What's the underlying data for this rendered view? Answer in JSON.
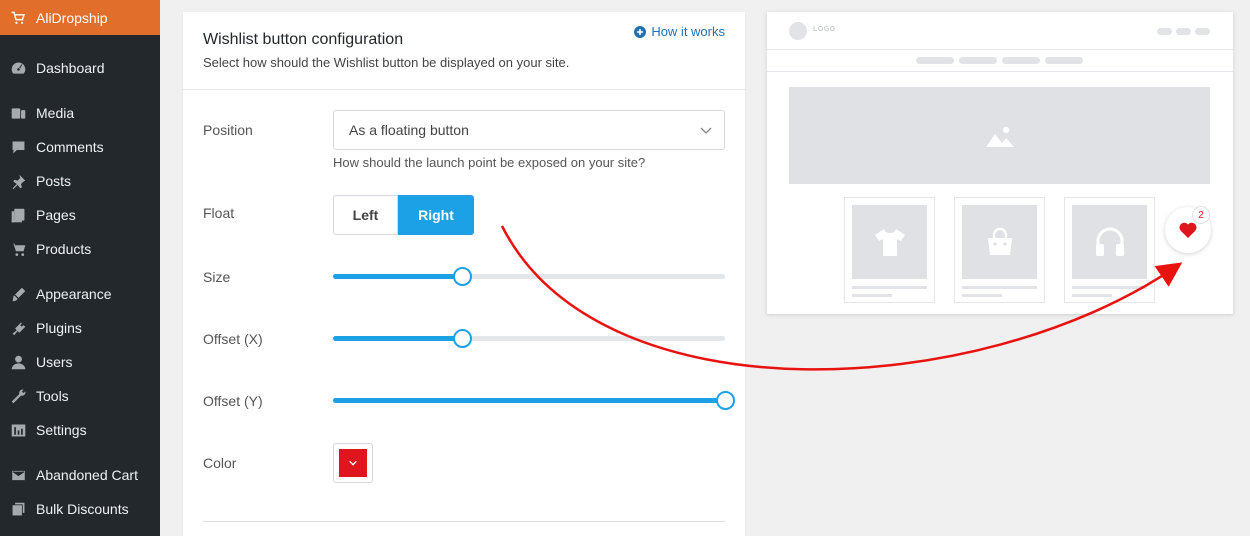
{
  "sidebar": {
    "brand": "AliDropship",
    "items": [
      {
        "label": "Dashboard",
        "icon": "dashboard-icon"
      },
      {
        "label": "Media",
        "icon": "media-icon"
      },
      {
        "label": "Comments",
        "icon": "comments-icon"
      },
      {
        "label": "Posts",
        "icon": "pin-icon"
      },
      {
        "label": "Pages",
        "icon": "pages-icon"
      },
      {
        "label": "Products",
        "icon": "cart-icon"
      },
      {
        "label": "Appearance",
        "icon": "brush-icon"
      },
      {
        "label": "Plugins",
        "icon": "plugin-icon"
      },
      {
        "label": "Users",
        "icon": "user-icon"
      },
      {
        "label": "Tools",
        "icon": "wrench-icon"
      },
      {
        "label": "Settings",
        "icon": "settings-icon"
      },
      {
        "label": "Abandoned Cart",
        "icon": "mail-icon"
      },
      {
        "label": "Bulk Discounts",
        "icon": "discount-icon"
      }
    ]
  },
  "card": {
    "title": "Wishlist button configuration",
    "subtitle": "Select how should the Wishlist button be displayed on your site.",
    "how_link": "How it works"
  },
  "form": {
    "position_label": "Position",
    "position_value": "As a floating button",
    "position_hint": "How should the launch point be exposed on your site?",
    "float_label": "Float",
    "float_left": "Left",
    "float_right": "Right",
    "float_selected": "Right",
    "size_label": "Size",
    "size_value": 0.33,
    "offset_x_label": "Offset (X)",
    "offset_x_value": 0.33,
    "offset_y_label": "Offset (Y)",
    "offset_y_value": 1.0,
    "color_label": "Color",
    "color_value": "#e0161f"
  },
  "preview": {
    "logo_text": "LOGO",
    "wishlist_count": "2",
    "accent": "#1da1e6"
  }
}
